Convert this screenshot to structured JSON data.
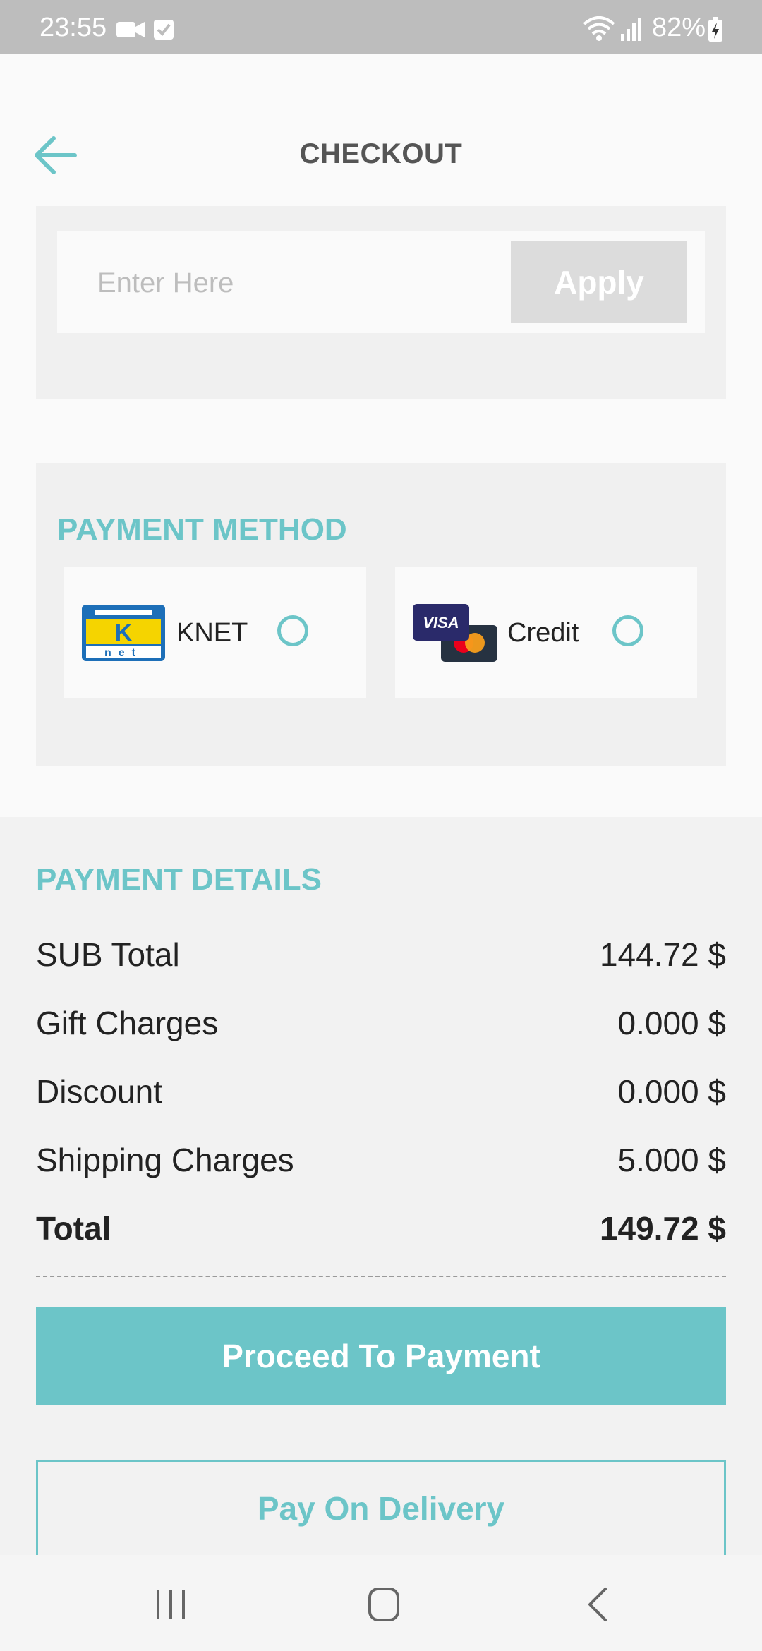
{
  "status_bar": {
    "time": "23:55",
    "battery": "82%",
    "icons": [
      "video-icon",
      "task-check-icon",
      "wifi-icon",
      "signal-icon",
      "battery-charging-icon"
    ]
  },
  "header": {
    "title": "CHECKOUT",
    "back_icon": "arrow-left-icon"
  },
  "coupon": {
    "placeholder": "Enter Here",
    "apply_label": "Apply"
  },
  "payment_method": {
    "title": "PAYMENT METHOD",
    "options": [
      {
        "label": "KNET",
        "logo": "knet-logo",
        "selected": false
      },
      {
        "label": "Credit",
        "logo": "visa-mastercard-logo",
        "selected": false
      }
    ]
  },
  "payment_details": {
    "title": "PAYMENT DETAILS",
    "rows": [
      {
        "label": "SUB Total",
        "value": "144.72 $"
      },
      {
        "label": "Gift Charges",
        "value": "0.000 $"
      },
      {
        "label": "Discount",
        "value": "0.000 $"
      },
      {
        "label": "Shipping Charges",
        "value": "5.000 $"
      },
      {
        "label": "Total",
        "value": "149.72 $"
      }
    ]
  },
  "actions": {
    "proceed_label": "Proceed To Payment",
    "delivery_label": "Pay On Delivery"
  },
  "colors": {
    "accent": "#6cc5c8",
    "apply_disabled": "#dcdcdc",
    "status_bar": "#bdbdbd"
  },
  "nav": [
    "recent-apps-icon",
    "home-icon",
    "back-icon"
  ]
}
